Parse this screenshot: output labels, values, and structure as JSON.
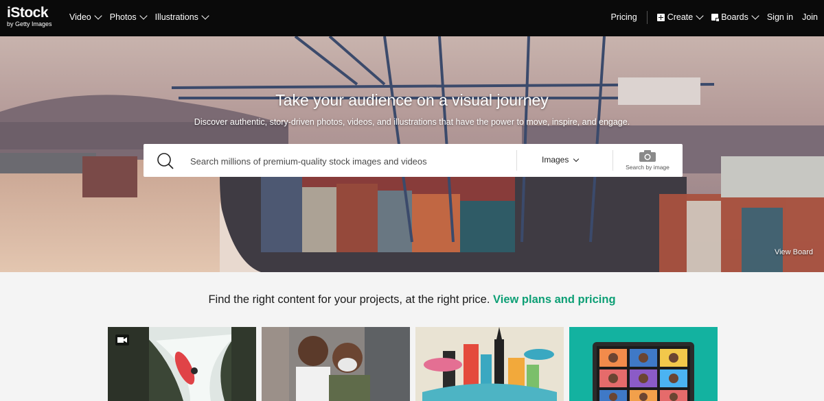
{
  "logo": {
    "main": "iStock",
    "sub": "by Getty Images"
  },
  "nav": {
    "left": [
      {
        "label": "Video"
      },
      {
        "label": "Photos"
      },
      {
        "label": "Illustrations"
      }
    ],
    "pricing": "Pricing",
    "create": "Create",
    "boards": "Boards",
    "sign_in": "Sign in",
    "join": "Join"
  },
  "hero": {
    "title": "Take your audience on a visual journey",
    "subtitle": "Discover authentic, story-driven photos, videos, and illustrations that have the power to move, inspire, and engage.",
    "search": {
      "placeholder": "Search millions of premium-quality stock images and videos",
      "media_type": "Images",
      "search_by_image": "Search by image"
    },
    "view_board": "View Board"
  },
  "promo": {
    "text": "Find the right content for your projects, at the right price.",
    "link": "View plans and pricing"
  },
  "cards": [
    {
      "name": "kayak-waterfall"
    },
    {
      "name": "smiling-men"
    },
    {
      "name": "city-illustration"
    },
    {
      "name": "video-call-laptop"
    }
  ],
  "colors": {
    "nav_bg": "#0a0a0a",
    "accent_green": "#0d9f75",
    "page_bg": "#f4f4f4",
    "card_teal": "#13b2a0"
  }
}
